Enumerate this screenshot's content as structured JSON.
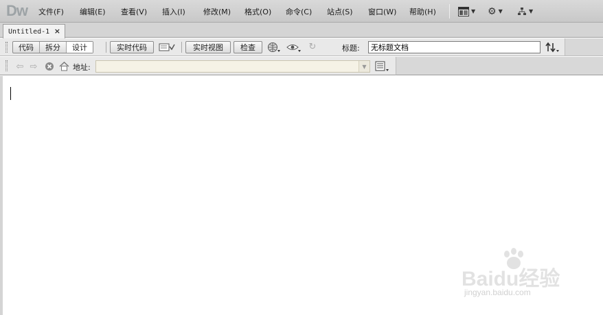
{
  "app": {
    "logo": "Dw"
  },
  "menu": [
    {
      "label": "文件(F)"
    },
    {
      "label": "编辑(E)"
    },
    {
      "label": "查看(V)"
    },
    {
      "label": "插入(I)"
    },
    {
      "label": "修改(M)"
    },
    {
      "label": "格式(O)"
    },
    {
      "label": "命令(C)"
    },
    {
      "label": "站点(S)"
    },
    {
      "label": "窗口(W)"
    },
    {
      "label": "帮助(H)"
    }
  ],
  "tab": {
    "label": "Untitled-1",
    "close": "×"
  },
  "view_buttons": {
    "code": "代码",
    "split": "拆分",
    "design": "设计"
  },
  "toolbar": {
    "live_code": "实时代码",
    "live_view": "实时视图",
    "inspect": "检查",
    "title_label": "标题:",
    "title_value": "无标题文档"
  },
  "address": {
    "label": "地址:",
    "value": ""
  },
  "watermark": {
    "text": "Baidu经验",
    "sub": "jingyan.baidu.com"
  },
  "colors": {
    "menubar": "#cfcfcf",
    "toolbar": "#e9e9e9",
    "address_field": "#f5f2e6"
  }
}
